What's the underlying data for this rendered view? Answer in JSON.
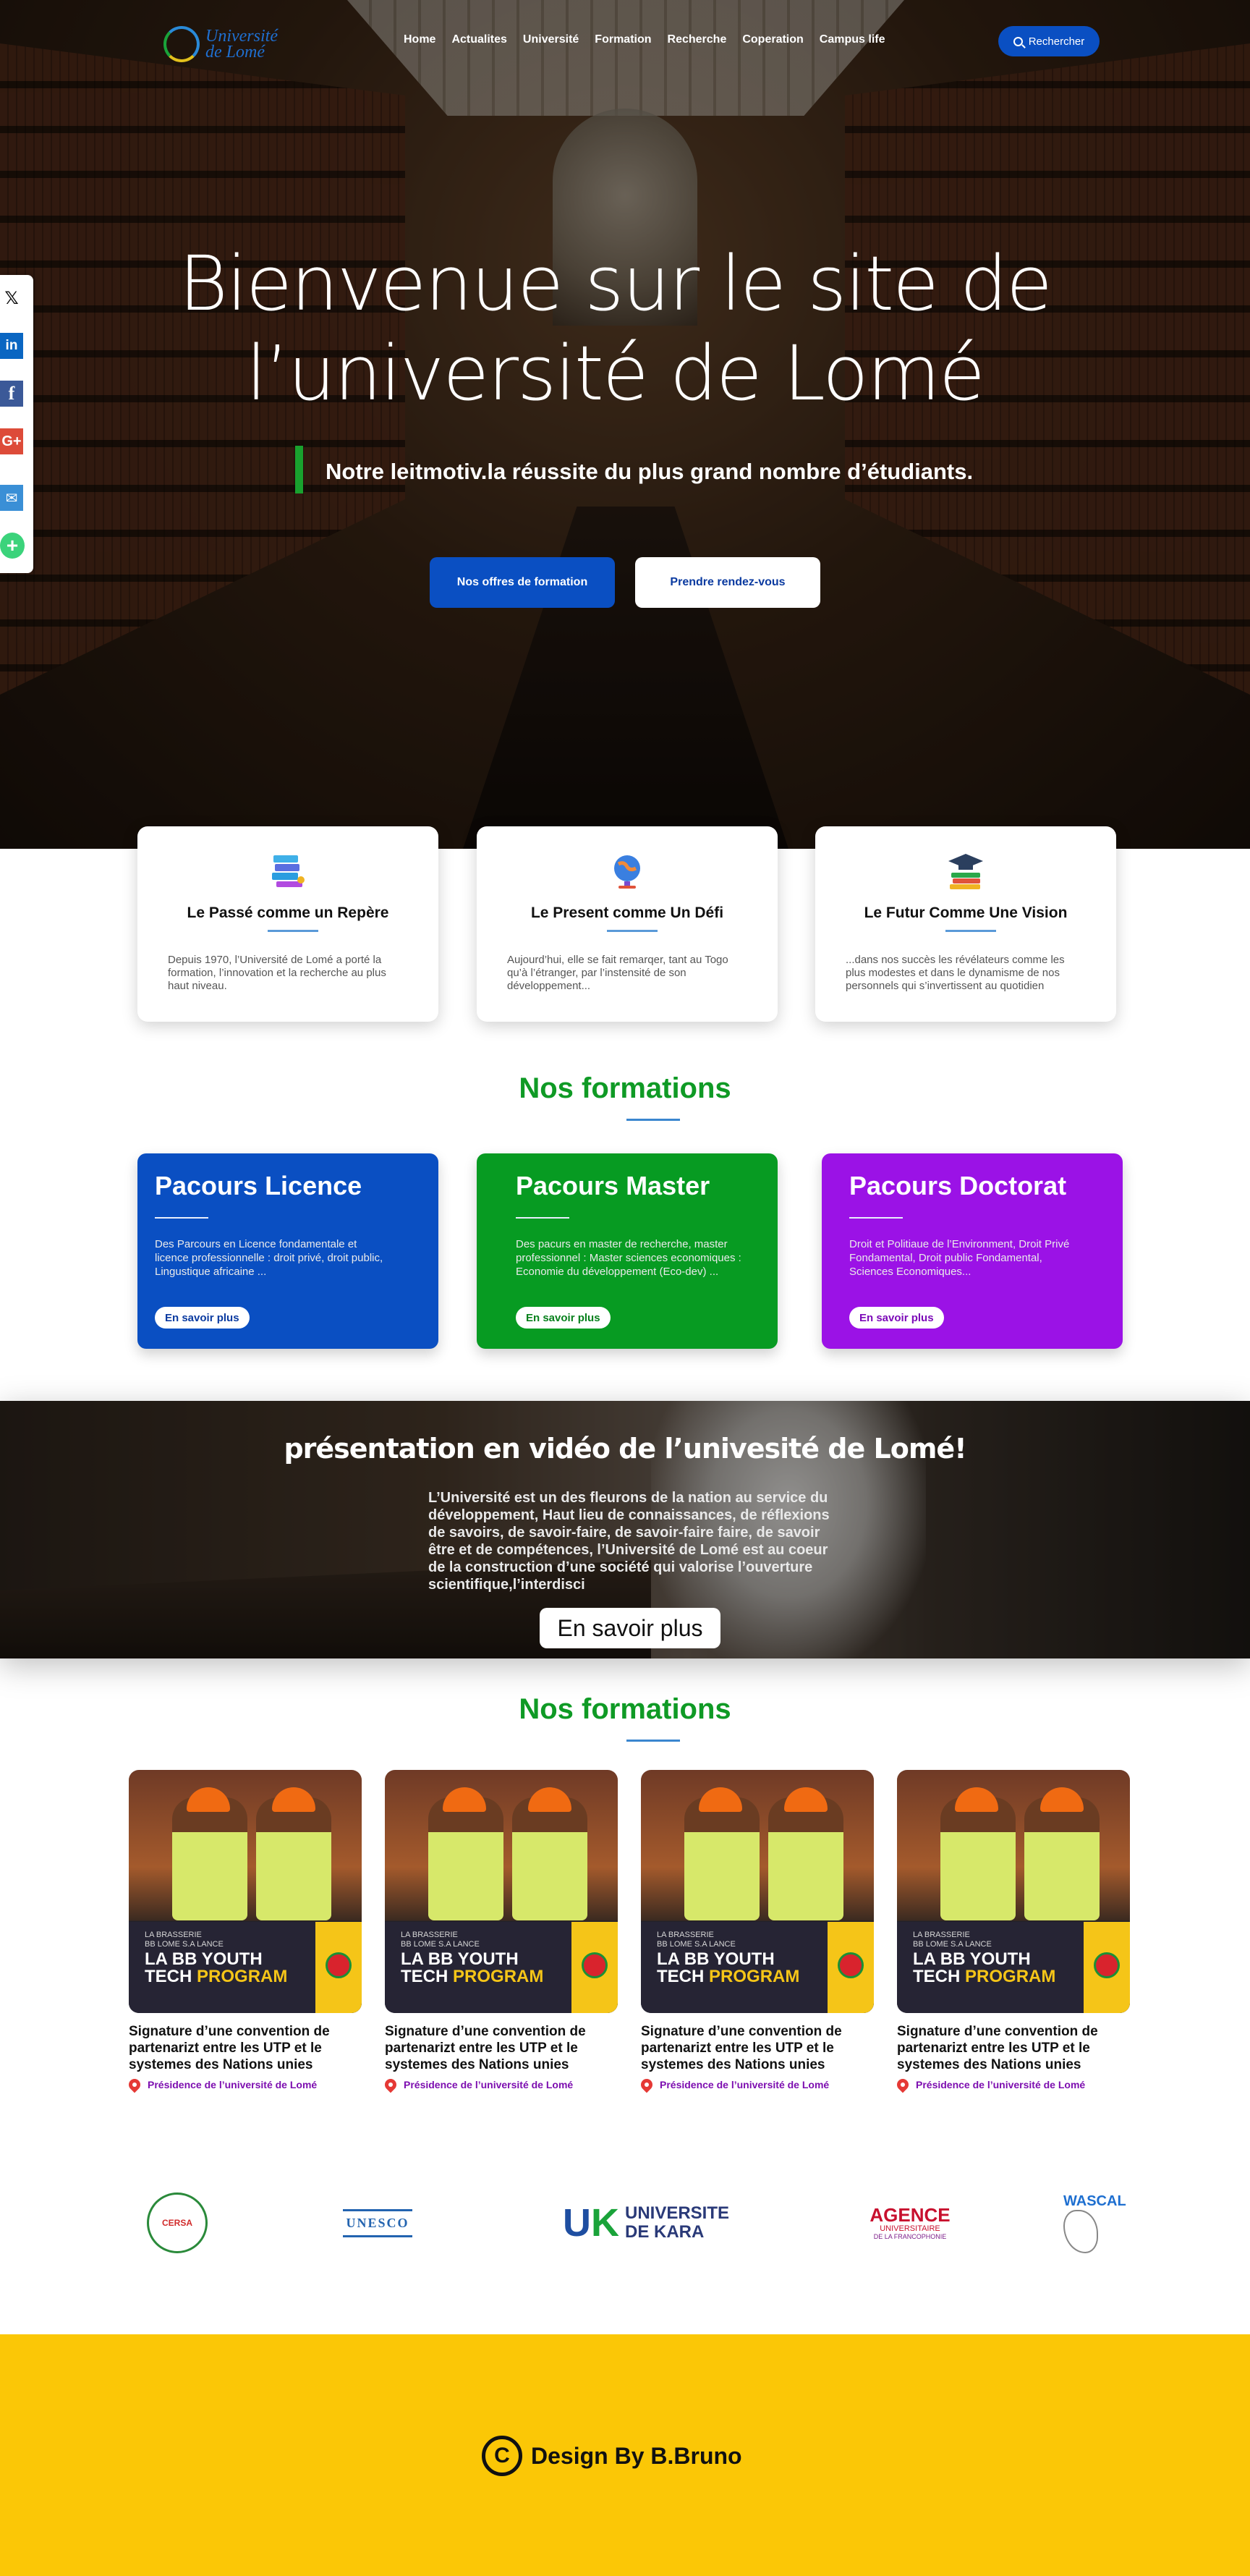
{
  "nav": {
    "logo_text": "Université\nde Lomé",
    "links": [
      "Home",
      "Actualites",
      "Université",
      "Formation",
      "Recherche",
      "Coperation",
      "Campus life"
    ],
    "search_label": "Rechercher"
  },
  "hero": {
    "title": "Bienvenue sur le site   de\nl’université de Lomé",
    "motto": "Notre leitmotiv.la réussite du plus grand nombre d’étudiants.",
    "cta_primary": "Nos offres de formation",
    "cta_secondary": "Prendre rendez-vous"
  },
  "social": [
    "x-icon",
    "linkedin-icon",
    "facebook-icon",
    "google-plus-icon",
    "email-icon",
    "share-plus-icon"
  ],
  "pillars": [
    {
      "title": "Le Passé comme un Repère",
      "text": "Depuis 1970, l’Université de Lomé a porté la formation, l’innovation et la recherche au plus haut niveau.",
      "icon": "books-stack-icon"
    },
    {
      "title": "Le Present comme Un Défi",
      "text": "Aujourd’hui, elle se fait remarqer, tant au Togo qu’à l’étranger, par l’instensité de son développement...",
      "icon": "globe-icon"
    },
    {
      "title": "Le Futur Comme Une Vision",
      "text": "...dans nos succès les révélateurs comme les plus modestes et dans le dynamisme de nos personnels qui s’invertissent au quotidien",
      "icon": "graduation-cap-icon"
    }
  ],
  "formations_title": "Nos formations",
  "programs": [
    {
      "title": "Pacours Licence",
      "text": "Des Parcours en Licence fondamentale et licence professionnelle : droit privé, droit public, Lingustique africaine ...",
      "button": "En savoir plus"
    },
    {
      "title": "Pacours Master",
      "text": "Des pacurs en master de recherche, master professionnel : Master sciences economiques : Economie du développement (Eco-dev) ...",
      "button": "En savoir plus"
    },
    {
      "title": "Pacours Doctorat",
      "text": "Droit et Politiaue de l’Environment, Droit Privé Fondamental, Droit  public Fondamental, Sciences Economiques...",
      "button": "En savoir plus"
    }
  ],
  "video": {
    "title": "présentation en vidéo de l’univesité de Lomé!",
    "text": "L’Université est un des fleurons de la nation au service du développement, Haut lieu de connaissances, de réflexions de savoirs, de savoir-faire, de savoir-faire faire, de savoir être et de compétences, l’Université de Lomé est au coeur de la construction d’une société qui valorise l’ouverture scientifique,l’interdisci",
    "button": "En savoir plus"
  },
  "news_title": "Nos formations",
  "news": [
    {
      "image_sub": "LA BRASSERIE\nBB LOME S.A LANCE",
      "image_title_1": "LA BB YOUTH",
      "image_title_2": "TECH",
      "image_title_3": "PROGRAM",
      "title": "Signature d’une convention de\npartenarizt entre les UTP et le\nsystemes des Nations  unies",
      "source": "Présidence de l’université de Lomé"
    },
    {
      "image_sub": "LA BRASSERIE\nBB LOME S.A LANCE",
      "image_title_1": "LA BB YOUTH",
      "image_title_2": "TECH",
      "image_title_3": "PROGRAM",
      "title": "Signature d’une convention de\npartenarizt entre les UTP et le\nsystemes des Nations  unies",
      "source": "Présidence de l’université de Lomé"
    },
    {
      "image_sub": "LA BRASSERIE\nBB LOME S.A LANCE",
      "image_title_1": "LA BB YOUTH",
      "image_title_2": "TECH",
      "image_title_3": "PROGRAM",
      "title": "Signature d’une convention de\npartenarizt entre les UTP et le\nsystemes des Nations  unies",
      "source": "Présidence de l’université de Lomé"
    },
    {
      "image_sub": "LA BRASSERIE\nBB LOME S.A LANCE",
      "image_title_1": "LA BB YOUTH",
      "image_title_2": "TECH",
      "image_title_3": "PROGRAM",
      "title": "Signature d’une convention de\npartenarizt entre les UTP et le\nsystemes des Nations  unies",
      "source": "Présidence de l’université de Lomé"
    }
  ],
  "partners": {
    "cersa": "CERSA",
    "unesco": "UNESCO",
    "kara_line1": "UNIVERSITE",
    "kara_line2": "DE KARA",
    "auf_line1": "AGENCE",
    "auf_line2": "UNIVERSITAIRE",
    "auf_line3": "DE LA FRANCOPHONIE",
    "wascal": "WASCAL"
  },
  "footer": {
    "symbol": "C",
    "credit": "Design By B.Bruno"
  },
  "colors": {
    "primary_blue": "#0a4fc2",
    "green": "#079b22",
    "purple": "#9b12e6",
    "footer_yellow": "#fbc706"
  }
}
